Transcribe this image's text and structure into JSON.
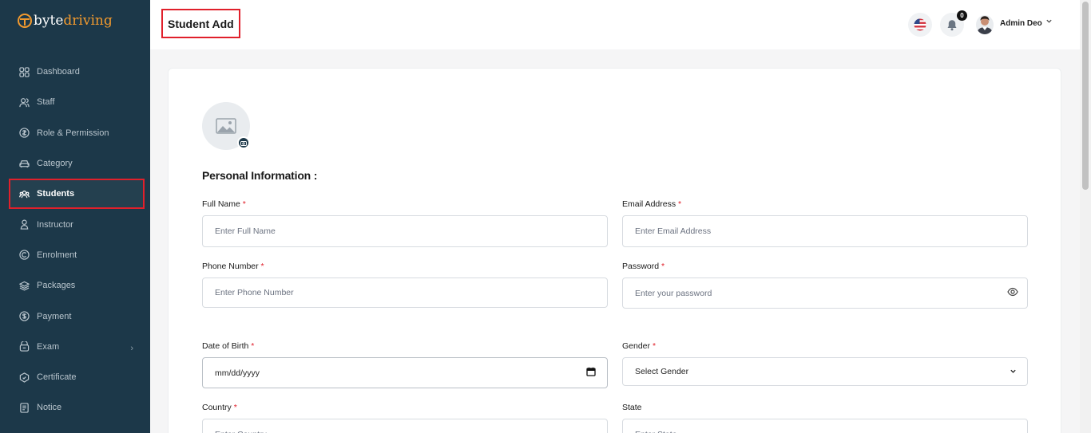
{
  "brand": {
    "part1": "byte",
    "part2": "driving"
  },
  "nav": [
    {
      "label": "Dashboard",
      "icon": "dashboard-grid-icon"
    },
    {
      "label": "Staff",
      "icon": "staff-users-icon"
    },
    {
      "label": "Role & Permission",
      "icon": "shield-icon"
    },
    {
      "label": "Category",
      "icon": "car-icon"
    },
    {
      "label": "Students",
      "icon": "students-group-icon",
      "active": true
    },
    {
      "label": "Instructor",
      "icon": "instructor-person-icon"
    },
    {
      "label": "Enrolment",
      "icon": "enrolment-badge-icon"
    },
    {
      "label": "Packages",
      "icon": "packages-layers-icon"
    },
    {
      "label": "Payment",
      "icon": "dollar-coin-icon"
    },
    {
      "label": "Exam",
      "icon": "exam-icon",
      "has_submenu": true
    },
    {
      "label": "Certificate",
      "icon": "certificate-icon"
    },
    {
      "label": "Notice",
      "icon": "notice-document-icon"
    }
  ],
  "header": {
    "title": "Student Add",
    "notification_count": "0",
    "user_name": "Admin Deo"
  },
  "form": {
    "section_title": "Personal Information :",
    "full_name": {
      "label": "Full Name",
      "placeholder": "Enter Full Name"
    },
    "email": {
      "label": "Email Address",
      "placeholder": "Enter Email Address"
    },
    "phone": {
      "label": "Phone Number",
      "placeholder": "Enter Phone Number"
    },
    "password": {
      "label": "Password",
      "placeholder": "Enter your password"
    },
    "dob": {
      "label": "Date of Birth",
      "value": "mm/dd/yyyy"
    },
    "gender": {
      "label": "Gender",
      "value": "Select Gender"
    },
    "country": {
      "label": "Country",
      "placeholder": "Enter Country"
    },
    "state": {
      "label": "State",
      "placeholder": "Enter State"
    },
    "required_mark": "*"
  },
  "colors": {
    "sidebar": "#1c3849",
    "accent": "#f29a2e",
    "highlight": "#e0202b"
  }
}
